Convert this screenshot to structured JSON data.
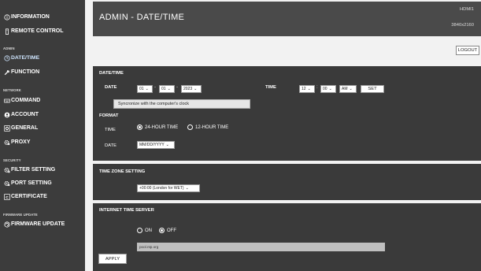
{
  "sidebar": {
    "information": "INFORMATION",
    "remote_control": "REMOTE CONTROL",
    "admin_section": "ADMIN",
    "date_time": "DATE/TIME",
    "function": "FUNCTION",
    "network_section": "NETWORK",
    "command": "COMMAND",
    "account": "ACCOUNT",
    "general": "GENERAL",
    "proxy": "PROXY",
    "security_section": "SECURITY",
    "filter_setting": "FILTER SETTING",
    "port_setting": "PORT SETTING",
    "certificate": "CERTIFICATE",
    "firmware_section": "FIRMWARE UPDATE",
    "firmware_update": "FIRMWARE UPDATE"
  },
  "header": {
    "title": "ADMIN - DATE/TIME",
    "input": "HDMI1",
    "resolution": "3840x2160",
    "logout": "LOGOUT"
  },
  "datetime": {
    "section_title": "DATE/TIME",
    "date_label": "DATE",
    "month": "01",
    "day": "01",
    "year": "2023",
    "time_label": "TIME",
    "hour": "12",
    "minute": "00",
    "ampm": "AM",
    "set": "SET",
    "tooltip": "Syncronize with the computer's clock",
    "dash": "-",
    "colon": ":"
  },
  "format": {
    "section_title": "FORMAT",
    "time_label": "TIME",
    "option_24": "24-HOUR TIME",
    "option_12": "12-HOUR TIME",
    "selected": "24-HOUR TIME",
    "date_label": "DATE",
    "date_format": "MM/DD/YYYY"
  },
  "timezone": {
    "section_title": "TIME ZONE SETTING",
    "value": "+00:00 (London for WET)"
  },
  "internet_time": {
    "section_title": "INTERNET TIME SERVER",
    "on": "ON",
    "off": "OFF",
    "selected": "OFF",
    "server": "pool.ntp.org",
    "apply": "APPLY"
  },
  "icons": {
    "information": "info-circle-icon",
    "remote_control": "remote-icon",
    "date_time": "clock-icon",
    "function": "wrench-icon",
    "command": "keyboard-icon",
    "account": "person-icon",
    "general": "gear-icon",
    "proxy": "network-gear-icon",
    "filter_setting": "shield-gear-icon",
    "port_setting": "network-gear-icon",
    "certificate": "certificate-icon",
    "firmware_update": "refresh-circle-icon"
  },
  "colors": {
    "sidebar_bg": "#3c3c3c",
    "panel_bg": "#3a3a3a",
    "page_bg": "#f2f2f2",
    "active_link": "#cfe6ff"
  }
}
